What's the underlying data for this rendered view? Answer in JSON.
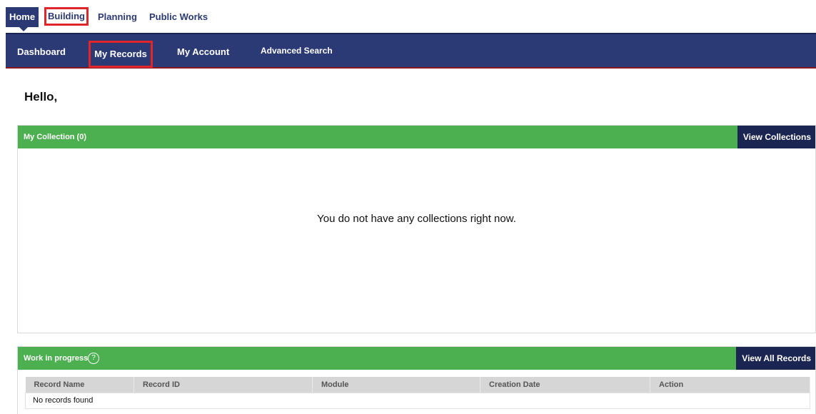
{
  "module_tabs": {
    "home": "Home",
    "building": "Building",
    "planning": "Planning",
    "public_works": "Public Works"
  },
  "nav": {
    "dashboard": "Dashboard",
    "my_records": "My Records",
    "my_account": "My Account",
    "advanced_search": "Advanced Search"
  },
  "greeting": "Hello,",
  "collection": {
    "title": "My Collection (0)",
    "button": "View Collections",
    "empty_message": "You do not have any collections right now."
  },
  "work_in_progress": {
    "title": "Work in progress",
    "help_icon": "question-circle-icon",
    "button": "View All Records",
    "columns": [
      "Record Name",
      "Record ID",
      "Module",
      "Creation Date",
      "Action"
    ],
    "empty_row": "No records found"
  },
  "colors": {
    "nav_blue": "#2b3a75",
    "panel_green": "#4caf50",
    "button_navy": "#1b2551",
    "highlight_red": "#e0262b"
  }
}
